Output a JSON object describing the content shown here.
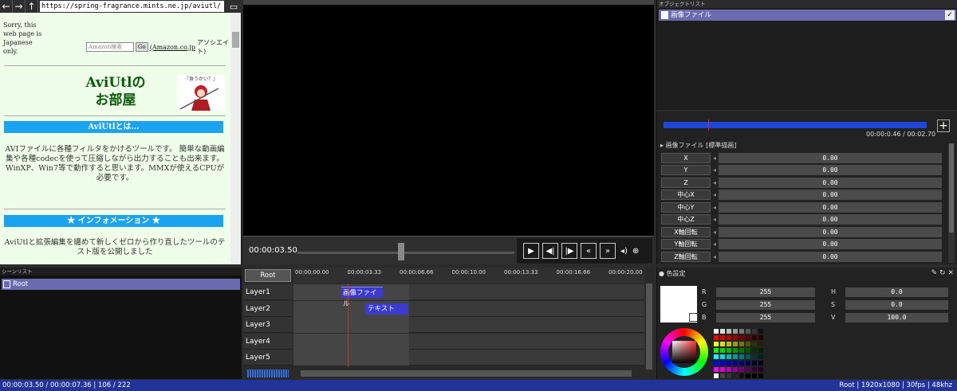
{
  "browser": {
    "url": "https://spring-fragrance.mints.ne.jp/aviutl/",
    "sorry": "Sorry, this web page is Japanese only.",
    "amazon_placeholder": "Amazon検索",
    "go": "Go",
    "amazon_link": "(Amazon.co.jp",
    "associate": "アソシエイト)",
    "title_line1": "AviUtlの",
    "title_line2": "お部屋",
    "mascot_caption": "『食うかい？』",
    "section1": "AviUtlとは…",
    "para1": "AVIファイルに各種フィルタをかけるツールです。 簡単な動画編集や各種codecを使って圧縮しながら出力することも出来ます。 WinXP、Win7等で動作すると思います。MMXが使えるCPUが必要です。",
    "section2": "★ インフォメーション ★",
    "para2": "AviUtlと拡張編集を纏めて新しくゼロから作り直したツールのテスト版を公開しました"
  },
  "preview": {
    "time": "00:00:03.50"
  },
  "object_list": {
    "header": "オブジェクトリスト",
    "item": "画像ファイル"
  },
  "props": {
    "times": "00:00:0.46 / 00:02.70",
    "header": "画像ファイル [標準描画]",
    "rows": [
      {
        "label": "X",
        "value": "0.00"
      },
      {
        "label": "Y",
        "value": "0.00"
      },
      {
        "label": "Z",
        "value": "0.00"
      },
      {
        "label": "中心X",
        "value": "0.00"
      },
      {
        "label": "中心Y",
        "value": "0.00"
      },
      {
        "label": "中心Z",
        "value": "0.00"
      },
      {
        "label": "X軸回転",
        "value": "0.00"
      },
      {
        "label": "Y軸回転",
        "value": "0.00"
      },
      {
        "label": "Z軸回転",
        "value": "0.00"
      }
    ]
  },
  "scene": {
    "header": "シーンリスト",
    "item": "Root"
  },
  "timeline": {
    "root": "Root",
    "ticks": [
      "00:00:00.00",
      "00:00:03.33",
      "00:00:06.66",
      "00:00:10.00",
      "00:00:13.33",
      "00:00:16.66",
      "00:00:20.00"
    ],
    "layers": [
      "Layer1",
      "Layer2",
      "Layer3",
      "Layer4",
      "Layer5"
    ],
    "clip1": "画像ファイル",
    "clip2": "テキスト"
  },
  "color": {
    "header": "色設定",
    "r": "255",
    "g": "255",
    "b": "255",
    "h": "0.0",
    "s": "0.0",
    "v": "100.0",
    "lr": "R",
    "lg": "G",
    "lb": "B",
    "lh": "H",
    "ls": "S",
    "lv": "V"
  },
  "status": {
    "left": "00:00:03.50 / 00:00:07.36  |  106 / 222",
    "right": "Root  |  1920x1080  |  30fps  |  48khz"
  }
}
